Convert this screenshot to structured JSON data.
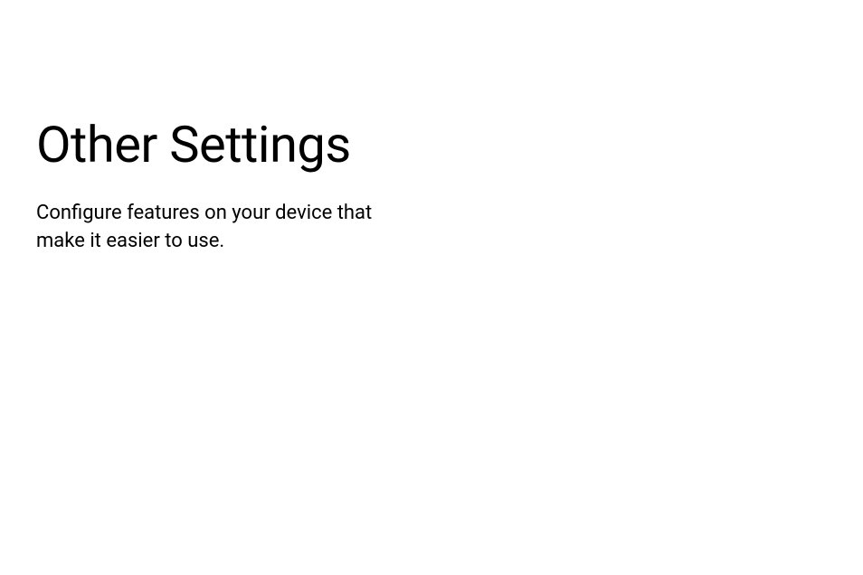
{
  "page": {
    "heading": "Other Settings",
    "description": "Configure features on your device that make it easier to use."
  }
}
